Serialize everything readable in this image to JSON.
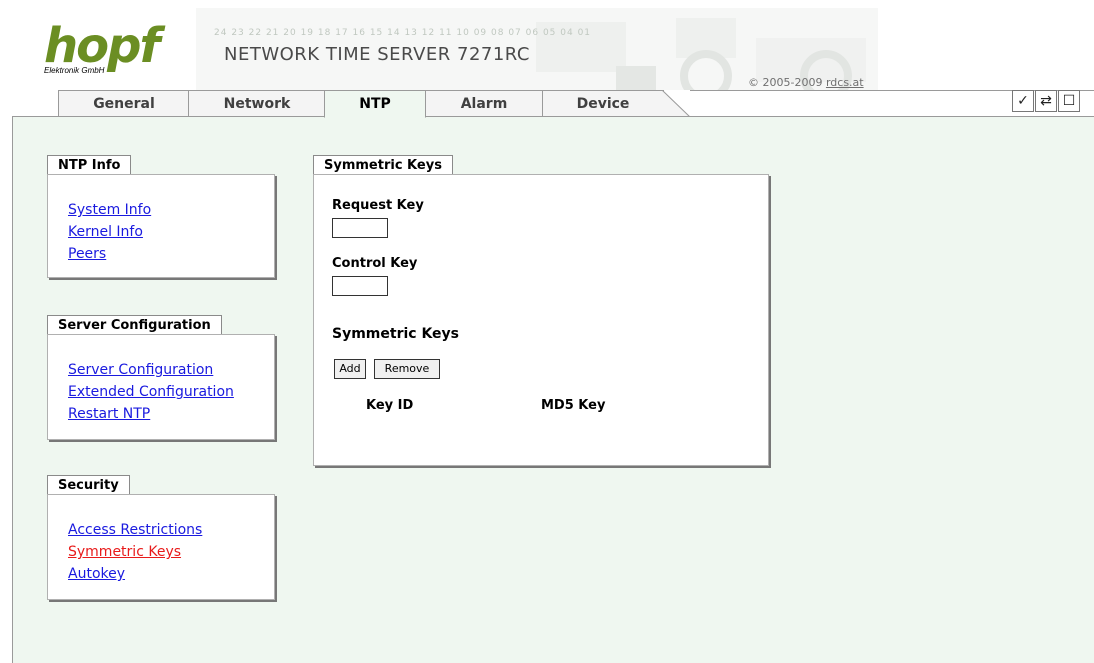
{
  "header": {
    "logo": "hopf",
    "logo_sub": "Elektronik GmbH",
    "ticker": "24 23 22 21 20 19 18 17 16 15 14 13 12 11 10 09 08 07 06 05 04 01",
    "product_title": "NETWORK TIME SERVER 7271RC",
    "copyright_prefix": "© 2005-2009 ",
    "copyright_link": "rdcs.at"
  },
  "tabs": [
    {
      "label": "General",
      "active": false
    },
    {
      "label": "Network",
      "active": false
    },
    {
      "label": "NTP",
      "active": true
    },
    {
      "label": "Alarm",
      "active": false
    },
    {
      "label": "Device",
      "active": false
    }
  ],
  "corner_icons": [
    "check-icon",
    "swap-icon",
    "window-icon"
  ],
  "sidebar": {
    "ntp_info": {
      "title": "NTP Info",
      "links": [
        "System Info",
        "Kernel Info",
        "Peers"
      ]
    },
    "server_config": {
      "title": "Server Configuration",
      "links": [
        "Server Configuration",
        "Extended Configuration",
        "Restart NTP"
      ]
    },
    "security": {
      "title": "Security",
      "links": [
        "Access Restrictions",
        "Symmetric Keys",
        "Autokey"
      ],
      "current": "Symmetric Keys"
    }
  },
  "main": {
    "panel_title": "Symmetric Keys",
    "request_key_label": "Request Key",
    "request_key_value": "",
    "control_key_label": "Control Key",
    "control_key_value": "",
    "section_title": "Symmetric Keys",
    "add_label": "Add",
    "remove_label": "Remove",
    "columns": [
      "Key ID",
      "MD5 Key"
    ]
  }
}
